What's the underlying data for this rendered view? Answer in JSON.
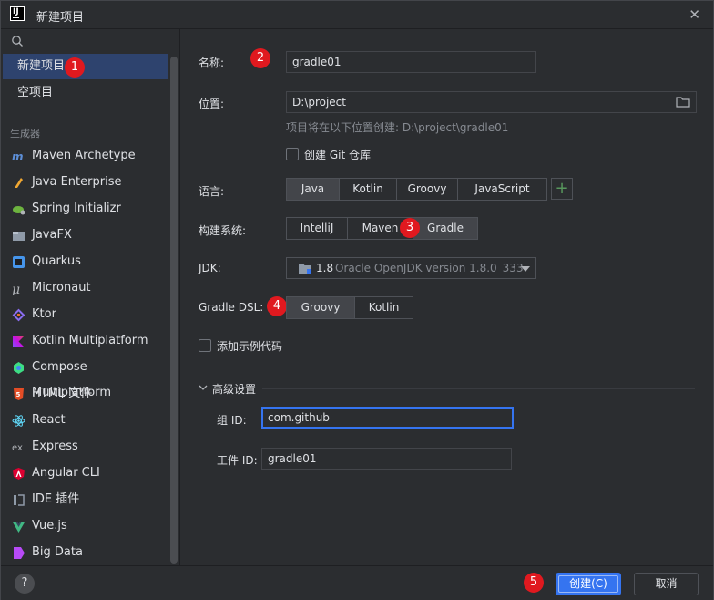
{
  "window": {
    "title": "新建项目",
    "close_glyph": "✕"
  },
  "sidebar": {
    "top_items": [
      {
        "label": "新建项目"
      },
      {
        "label": "空项目"
      }
    ],
    "section_label": "生成器",
    "generators": [
      {
        "label": "Maven Archetype",
        "icon": "maven-icon"
      },
      {
        "label": "Java Enterprise",
        "icon": "java-enterprise-icon"
      },
      {
        "label": "Spring Initializr",
        "icon": "spring-icon"
      },
      {
        "label": "JavaFX",
        "icon": "javafx-icon"
      },
      {
        "label": "Quarkus",
        "icon": "quarkus-icon"
      },
      {
        "label": "Micronaut",
        "icon": "micronaut-icon"
      },
      {
        "label": "Ktor",
        "icon": "ktor-icon"
      },
      {
        "label": "Kotlin Multiplatform",
        "icon": "kotlin-icon"
      },
      {
        "label": "Compose Multiplatform",
        "icon": "compose-icon"
      },
      {
        "label": "HTML 文件",
        "icon": "html5-icon"
      },
      {
        "label": "React",
        "icon": "react-icon"
      },
      {
        "label": "Express",
        "icon": "express-icon"
      },
      {
        "label": "Angular CLI",
        "icon": "angular-icon"
      },
      {
        "label": "IDE 插件",
        "icon": "plugin-icon"
      },
      {
        "label": "Vue.js",
        "icon": "vue-icon"
      },
      {
        "label": "Big Data",
        "icon": "bigdata-icon"
      }
    ]
  },
  "form": {
    "name_label": "名称:",
    "name_value": "gradle01",
    "location_label": "位置:",
    "location_value": "D:\\project",
    "location_hint": "项目将在以下位置创建: D:\\project\\gradle01",
    "git_label": "创建 Git 仓库",
    "language_label": "语言:",
    "languages": [
      "Java",
      "Kotlin",
      "Groovy",
      "JavaScript"
    ],
    "language_selected": "Java",
    "plus_glyph": "+",
    "build_label": "构建系统:",
    "build_systems": [
      "IntelliJ",
      "Maven",
      "Gradle"
    ],
    "build_selected": "Gradle",
    "jdk_label": "JDK:",
    "jdk_version": "1.8",
    "jdk_name": "Oracle OpenJDK version 1.8.0_333",
    "dsl_label": "Gradle DSL:",
    "dsl_options": [
      "Groovy",
      "Kotlin"
    ],
    "dsl_selected": "Groovy",
    "sample_label": "添加示例代码",
    "advanced_label": "高级设置",
    "group_label": "组 ID:",
    "group_value": "com.github",
    "artifact_label": "工件 ID:",
    "artifact_value": "gradle01"
  },
  "buttons": {
    "help": "?",
    "create": "创建(C)",
    "cancel": "取消"
  },
  "badges": [
    "1",
    "2",
    "3",
    "4",
    "5"
  ],
  "colors": {
    "accent": "#3574f0",
    "badge": "#e0191f",
    "selection": "#2e436e"
  }
}
